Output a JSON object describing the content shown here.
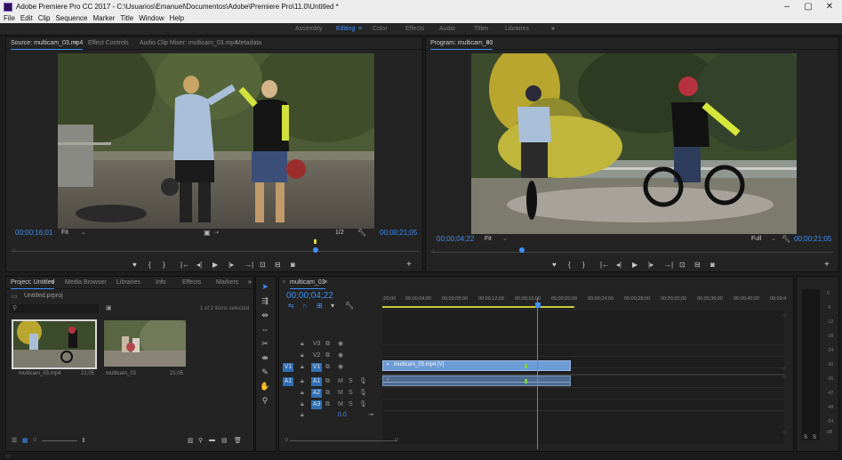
{
  "window": {
    "title": "Adobe Premiere Pro CC 2017 - C:\\Usuarios\\Emanuel\\Documentos\\Adobe\\Premiere Pro\\11.0\\Untitled *"
  },
  "menu": [
    "File",
    "Edit",
    "Clip",
    "Sequence",
    "Marker",
    "Title",
    "Window",
    "Help"
  ],
  "workspaces": {
    "items": [
      "Assembly",
      "Editing",
      "Color",
      "Effects",
      "Audio",
      "Titles",
      "Libraries"
    ],
    "active": "Editing",
    "menu_glyph": "≡",
    "more_glyph": "»"
  },
  "source_monitor": {
    "tabs": [
      "Source: multicam_03.mp4",
      "Effect Controls",
      "Audio Clip Mixer: multicam_03.mp4",
      "Metadata"
    ],
    "timecode_in": "00;00;16;01",
    "fit": "Fit",
    "scale": "1/2",
    "timecode_out": "00;00;21;05"
  },
  "program_monitor": {
    "title": "Program: multicam_03",
    "timecode_in": "00;00;04;22",
    "fit": "Fit",
    "quality": "Full",
    "timecode_out": "00;00;21;05"
  },
  "project_panel": {
    "tabs": [
      "Project: Untitled",
      "Media Browser",
      "Libraries",
      "Info",
      "Effects",
      "Markers"
    ],
    "file": "Untitled.prproj",
    "items_selected": "1 of 2 items selected",
    "items": [
      {
        "name": "multicam_03.mp4",
        "duration": "21;05"
      },
      {
        "name": "multicam_03",
        "duration": "21;05"
      }
    ]
  },
  "timeline": {
    "sequence_tab": "multicam_03",
    "timecode": "00;00;04;22",
    "ruler": [
      ";00;00",
      "00;00;04;00",
      "00;00;08;00",
      "00;00;12;00",
      "00;00;16;00",
      "00;00;20;00",
      "00;00;24;00",
      "00;00;28;00",
      "00;00;32;00",
      "00;00;36;00",
      "00;00;40;00",
      "00;00;4"
    ],
    "video_tracks": [
      "V3",
      "V2",
      "V1"
    ],
    "audio_tracks": [
      "A1",
      "A2",
      "A3"
    ],
    "source_patch_v": "V1",
    "source_patch_a": "A1",
    "track_buttons": {
      "mute": "M",
      "solo": "S"
    },
    "master_value": "0.0",
    "clip_label": "multicam_03.mp4 [V]",
    "clip_fraction": 0.52,
    "playhead_fraction": 0.12
  },
  "audio_meter": {
    "scale": [
      "0",
      "-6",
      "-12",
      "-18",
      "-24",
      "-30",
      "-36",
      "-42",
      "-48",
      "-54",
      "dB"
    ],
    "solo": [
      "S",
      "S"
    ]
  },
  "colors": {
    "accent": "#3f8ff7",
    "clip_video": "#6d9bd6",
    "clip_audio": "#4e6a8f",
    "timecode": "#3e8ef2"
  }
}
